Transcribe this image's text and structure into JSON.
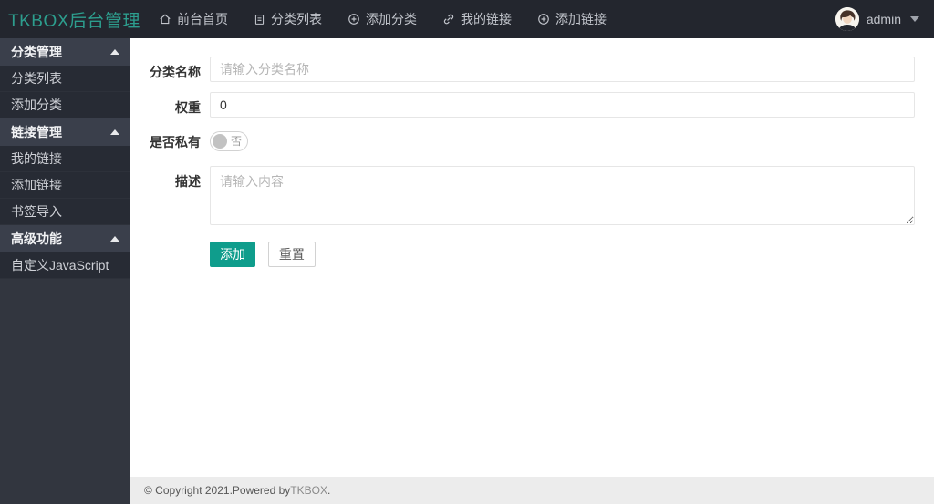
{
  "navbar": {
    "brand": "TKBOX后台管理",
    "items": [
      {
        "label": "前台首页",
        "icon": "home-icon"
      },
      {
        "label": "分类列表",
        "icon": "file-icon"
      },
      {
        "label": "添加分类",
        "icon": "plus-circle-icon"
      },
      {
        "label": "我的链接",
        "icon": "link-icon"
      },
      {
        "label": "添加链接",
        "icon": "plus-circle-icon"
      }
    ],
    "user": {
      "name": "admin"
    }
  },
  "sidebar": {
    "sections": [
      {
        "title": "分类管理",
        "items": [
          "分类列表",
          "添加分类"
        ]
      },
      {
        "title": "链接管理",
        "items": [
          "我的链接",
          "添加链接",
          "书签导入"
        ]
      },
      {
        "title": "高级功能",
        "items": [
          "自定义JavaScript"
        ]
      }
    ]
  },
  "form": {
    "fields": {
      "name": {
        "label": "分类名称",
        "placeholder": "请输入分类名称"
      },
      "weight": {
        "label": "权重",
        "value": "0"
      },
      "private": {
        "label": "是否私有",
        "state": "否"
      },
      "description": {
        "label": "描述",
        "placeholder": "请输入内容"
      }
    },
    "buttons": {
      "submit": "添加",
      "reset": "重置"
    }
  },
  "footer": {
    "prefix": "© Copyright 2021.Powered by ",
    "brand": "TKBOX",
    "suffix": "."
  },
  "colors": {
    "accent": "#0f9d8c",
    "brand_text": "#2d9e8e",
    "navbar_bg": "#23262e",
    "sidebar_bg": "#32363f",
    "sidebar_header_bg": "#3a3f4b",
    "sidebar_item_bg": "#272b34",
    "footer_bg": "#ececec"
  }
}
